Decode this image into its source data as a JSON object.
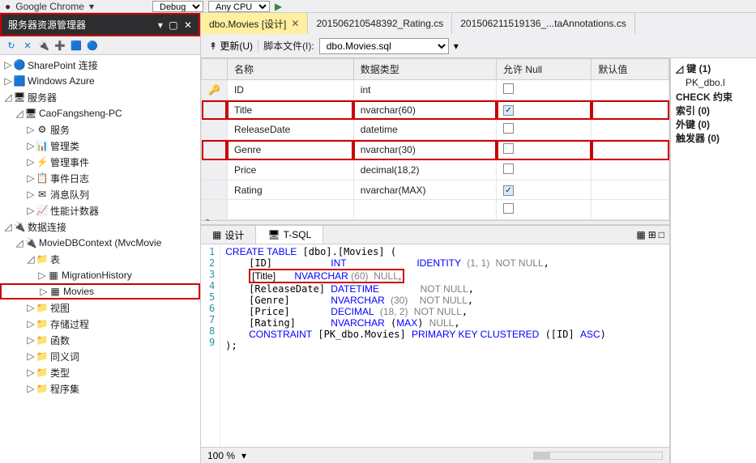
{
  "topbar": {
    "chrome": "Google Chrome",
    "config": "Debug",
    "platform": "Any CPU"
  },
  "panel": {
    "title": "服务器资源管理器",
    "tree": [
      {
        "lvl": 0,
        "tw": "▷",
        "ic": "🔵",
        "txt": "SharePoint 连接"
      },
      {
        "lvl": 0,
        "tw": "▷",
        "ic": "🟦",
        "txt": "Windows Azure"
      },
      {
        "lvl": 0,
        "tw": "◿",
        "ic": "🖥",
        "txt": "服务器"
      },
      {
        "lvl": 1,
        "tw": "◿",
        "ic": "🖥",
        "txt": "CaoFangsheng-PC"
      },
      {
        "lvl": 2,
        "tw": "▷",
        "ic": "⚙",
        "txt": "服务"
      },
      {
        "lvl": 2,
        "tw": "▷",
        "ic": "📊",
        "txt": "管理类"
      },
      {
        "lvl": 2,
        "tw": "▷",
        "ic": "⚡",
        "txt": "管理事件"
      },
      {
        "lvl": 2,
        "tw": "▷",
        "ic": "📋",
        "txt": "事件日志"
      },
      {
        "lvl": 2,
        "tw": "▷",
        "ic": "✉",
        "txt": "消息队列"
      },
      {
        "lvl": 2,
        "tw": "▷",
        "ic": "📈",
        "txt": "性能计数器"
      },
      {
        "lvl": 0,
        "tw": "◿",
        "ic": "🔌",
        "txt": "数据连接"
      },
      {
        "lvl": 1,
        "tw": "◿",
        "ic": "🔌",
        "txt": "MovieDBContext (MvcMovie"
      },
      {
        "lvl": 2,
        "tw": "◿",
        "ic": "📁",
        "txt": "表"
      },
      {
        "lvl": 3,
        "tw": "▷",
        "ic": "▦",
        "txt": "MigrationHistory"
      },
      {
        "lvl": 3,
        "tw": "▷",
        "ic": "▦",
        "txt": "Movies",
        "red": true
      },
      {
        "lvl": 2,
        "tw": "▷",
        "ic": "📁",
        "txt": "视图"
      },
      {
        "lvl": 2,
        "tw": "▷",
        "ic": "📁",
        "txt": "存储过程"
      },
      {
        "lvl": 2,
        "tw": "▷",
        "ic": "📁",
        "txt": "函数"
      },
      {
        "lvl": 2,
        "tw": "▷",
        "ic": "📁",
        "txt": "同义词"
      },
      {
        "lvl": 2,
        "tw": "▷",
        "ic": "📁",
        "txt": "类型"
      },
      {
        "lvl": 2,
        "tw": "▷",
        "ic": "📁",
        "txt": "程序集"
      }
    ]
  },
  "tabs": [
    {
      "label": "dbo.Movies [设计]",
      "active": true
    },
    {
      "label": "201506210548392_Rating.cs"
    },
    {
      "label": "201506211519136_...taAnnotations.cs"
    }
  ],
  "doc": {
    "update": "更新(U)",
    "scriptLabel": "脚本文件(I):",
    "scriptFile": "dbo.Movies.sql"
  },
  "grid": {
    "headers": {
      "name": "名称",
      "type": "数据类型",
      "null": "允许 Null",
      "default": "默认值"
    },
    "rows": [
      {
        "key": true,
        "name": "ID",
        "type": "int",
        "null": false
      },
      {
        "name": "Title",
        "type": "nvarchar(60)",
        "null": true,
        "hl": true
      },
      {
        "name": "ReleaseDate",
        "type": "datetime",
        "null": false
      },
      {
        "name": "Genre",
        "type": "nvarchar(30)",
        "null": false,
        "hl": true
      },
      {
        "name": "Price",
        "type": "decimal(18,2)",
        "null": false
      },
      {
        "name": "Rating",
        "type": "nvarchar(MAX)",
        "null": true
      }
    ]
  },
  "btabs": {
    "design": "设计",
    "tsql": "T-SQL"
  },
  "side": {
    "keys": "键 (1)",
    "pk": "PK_dbo.l",
    "check": "CHECK 约束",
    "index": "索引 (0)",
    "fk": "外键 (0)",
    "trigger": "触发器 (0)"
  },
  "sql": {
    "zoom": "100 %"
  }
}
